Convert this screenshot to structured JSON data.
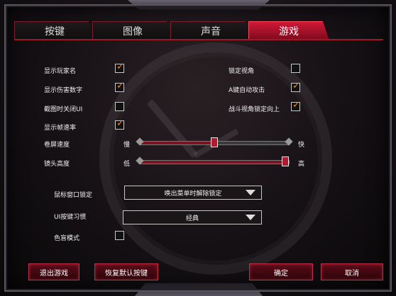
{
  "tabs": [
    {
      "label": "按键",
      "active": false
    },
    {
      "label": "图像",
      "active": false
    },
    {
      "label": "声音",
      "active": false
    },
    {
      "label": "游戏",
      "active": true
    }
  ],
  "left_options": [
    {
      "label": "显示玩家名",
      "checked": true
    },
    {
      "label": "显示伤害数字",
      "checked": true
    },
    {
      "label": "截图时关闭UI",
      "checked": false
    },
    {
      "label": "显示帧速率",
      "checked": true
    }
  ],
  "right_options": [
    {
      "label": "锁定视角",
      "checked": false
    },
    {
      "label": "A键自动攻击",
      "checked": true
    },
    {
      "label": "战斗视角锁定向上",
      "checked": true
    }
  ],
  "sliders": [
    {
      "label": "卷屏速度",
      "min_label": "慢",
      "max_label": "快",
      "value": 0.5
    },
    {
      "label": "镜头高度",
      "min_label": "低",
      "max_label": "高",
      "value": 1.0
    }
  ],
  "dropdowns": [
    {
      "label": "鼠标窗口锁定",
      "value": "唤出菜单时解除锁定"
    },
    {
      "label": "UI按键习惯",
      "value": "经典"
    }
  ],
  "colorblind": {
    "label": "色盲模式",
    "checked": false
  },
  "buttons": {
    "exit": "退出游戏",
    "reset": "恢复默认按键",
    "confirm": "确定",
    "cancel": "取消"
  },
  "colors": {
    "accent": "#d01838",
    "check": "#f08a20"
  }
}
